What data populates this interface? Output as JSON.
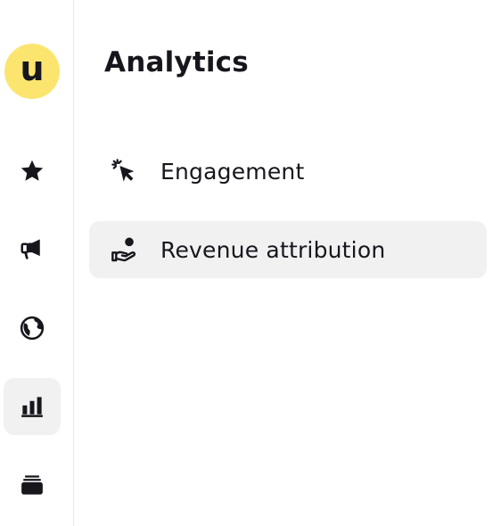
{
  "brand": {
    "logo_letter": "u",
    "logo_color": "#fbe56f"
  },
  "rail": {
    "items": [
      {
        "icon": "star-icon",
        "active": false
      },
      {
        "icon": "megaphone-icon",
        "active": false
      },
      {
        "icon": "globe-icon",
        "active": false
      },
      {
        "icon": "bar-chart-icon",
        "active": true
      },
      {
        "icon": "stack-icon",
        "active": false
      }
    ]
  },
  "main": {
    "title": "Analytics",
    "items": [
      {
        "label": "Engagement",
        "icon": "cursor-click-icon",
        "active": false
      },
      {
        "label": "Revenue attribution",
        "icon": "hand-coin-icon",
        "active": true
      }
    ]
  },
  "colors": {
    "text": "#16161d",
    "active_bg": "#f1f1f2",
    "divider": "#e6e6ea"
  }
}
